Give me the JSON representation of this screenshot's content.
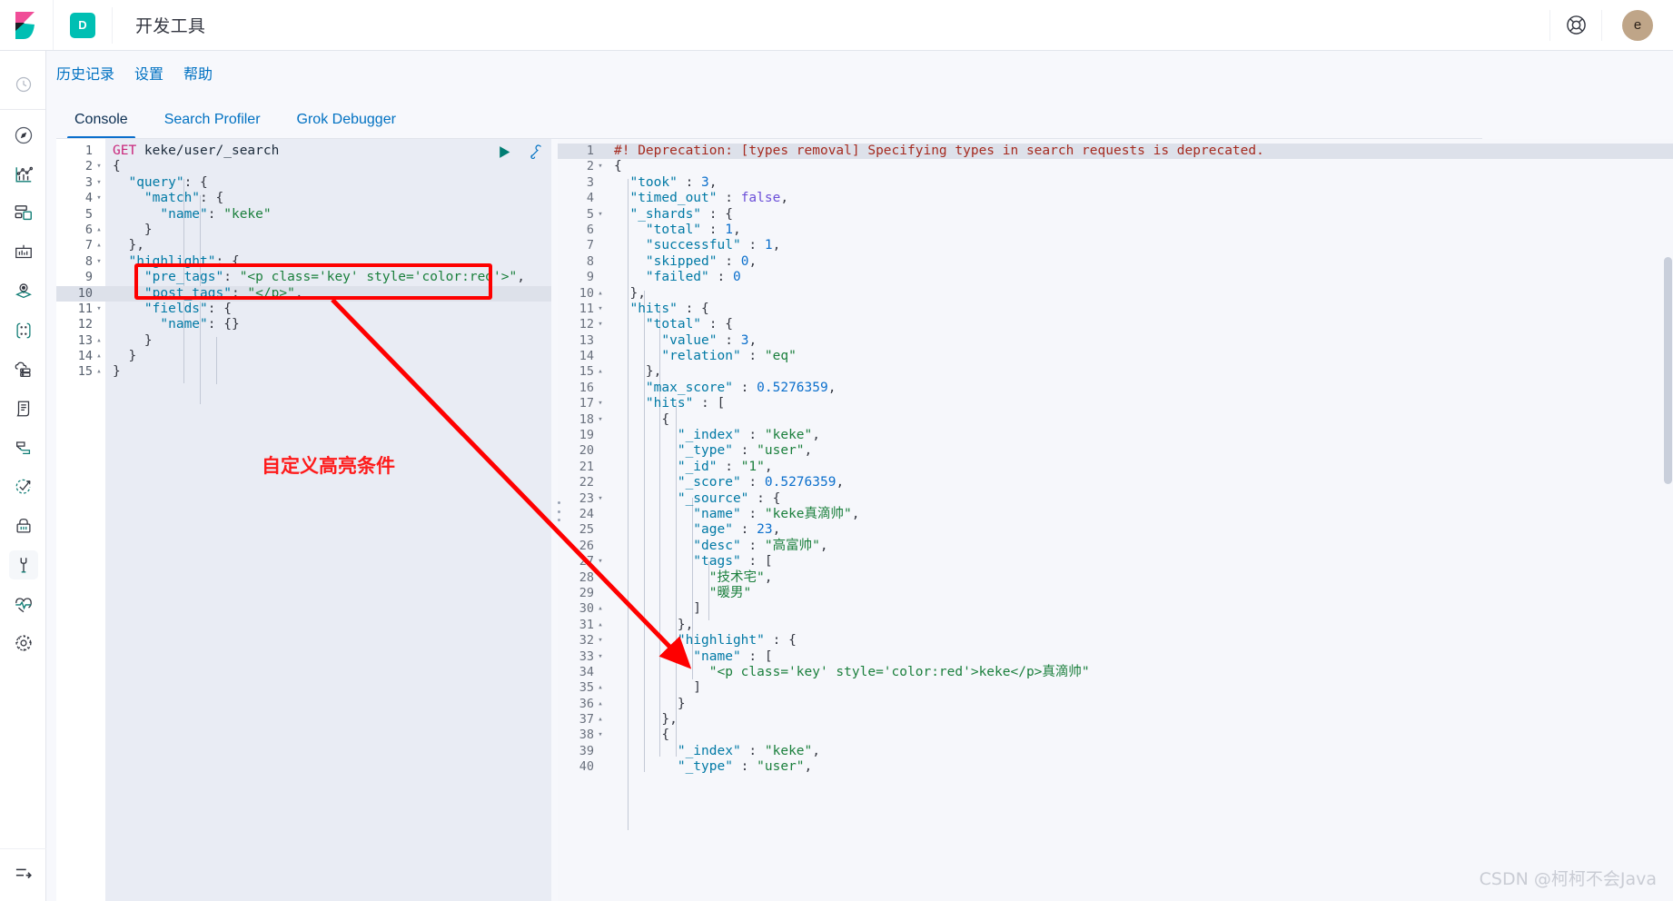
{
  "header": {
    "logo_icon": "kibana-logo-icon",
    "app_badge": "D",
    "title": "开发工具",
    "help_icon": "help-lifering-icon",
    "avatar_initial": "e"
  },
  "rail": {
    "items": [
      {
        "icon": "recently-viewed-clock-icon",
        "name": "recently-viewed"
      },
      {
        "icon": "compass-discover-icon",
        "name": "discover"
      },
      {
        "icon": "visualize-chart-icon",
        "name": "visualize"
      },
      {
        "icon": "dashboard-grid-icon",
        "name": "dashboard"
      },
      {
        "icon": "canvas-easel-icon",
        "name": "canvas"
      },
      {
        "icon": "maps-layers-pin-icon",
        "name": "maps"
      },
      {
        "icon": "machine-learning-nodes-icon",
        "name": "machine-learning"
      },
      {
        "icon": "infrastructure-cloud-server-icon",
        "name": "infrastructure"
      },
      {
        "icon": "logs-scroll-icon",
        "name": "logs"
      },
      {
        "icon": "apm-stack-icon",
        "name": "apm"
      },
      {
        "icon": "uptime-check-arrow-icon",
        "name": "uptime"
      },
      {
        "icon": "siem-lock-icon",
        "name": "siem"
      },
      {
        "icon": "dev-tools-wrench-icon",
        "name": "dev-tools",
        "selected": true
      },
      {
        "icon": "monitoring-heartbeat-icon",
        "name": "monitoring"
      },
      {
        "icon": "management-gear-icon",
        "name": "management"
      }
    ],
    "collapse_icon": "collapse-arrow-icon"
  },
  "subnav": {
    "items": [
      {
        "label": "历史记录",
        "name": "history"
      },
      {
        "label": "设置",
        "name": "settings"
      },
      {
        "label": "帮助",
        "name": "help"
      }
    ]
  },
  "tabs": [
    {
      "label": "Console",
      "name": "console",
      "active": true
    },
    {
      "label": "Search Profiler",
      "name": "search-profiler",
      "active": false
    },
    {
      "label": "Grok Debugger",
      "name": "grok-debugger",
      "active": false
    }
  ],
  "editor_actions": {
    "run_icon": "play-run-icon",
    "wrench_icon": "wrench-settings-icon"
  },
  "request_editor": {
    "name": "request-editor",
    "highlighted_line": 10,
    "lines": [
      {
        "n": 1,
        "fold": "",
        "tokens": [
          {
            "c": "t-method",
            "t": "GET"
          },
          {
            "c": "t-url",
            "t": " keke/user/_search"
          }
        ]
      },
      {
        "n": 2,
        "fold": "▾",
        "tokens": [
          {
            "c": "t-punc",
            "t": "{"
          }
        ]
      },
      {
        "n": 3,
        "fold": "▾",
        "tokens": [
          {
            "c": "t-key",
            "t": "  \"query\""
          },
          {
            "c": "t-punc",
            "t": ": {"
          }
        ]
      },
      {
        "n": 4,
        "fold": "▾",
        "tokens": [
          {
            "c": "t-key",
            "t": "    \"match\""
          },
          {
            "c": "t-punc",
            "t": ": {"
          }
        ]
      },
      {
        "n": 5,
        "fold": "",
        "tokens": [
          {
            "c": "t-key",
            "t": "      \"name\""
          },
          {
            "c": "t-punc",
            "t": ": "
          },
          {
            "c": "t-str",
            "t": "\"keke\""
          }
        ]
      },
      {
        "n": 6,
        "fold": "▴",
        "tokens": [
          {
            "c": "t-punc",
            "t": "    }"
          }
        ]
      },
      {
        "n": 7,
        "fold": "▴",
        "tokens": [
          {
            "c": "t-punc",
            "t": "  },"
          }
        ]
      },
      {
        "n": 8,
        "fold": "▾",
        "tokens": [
          {
            "c": "t-key",
            "t": "  \"highlight\""
          },
          {
            "c": "t-punc",
            "t": ": {"
          }
        ]
      },
      {
        "n": 9,
        "fold": "",
        "tokens": [
          {
            "c": "t-key",
            "t": "    \"pre_tags\""
          },
          {
            "c": "t-punc",
            "t": ": "
          },
          {
            "c": "t-str",
            "t": "\"<p class='key' style='color:red'>\""
          },
          {
            "c": "t-punc",
            "t": ","
          }
        ]
      },
      {
        "n": 10,
        "fold": "",
        "tokens": [
          {
            "c": "t-key",
            "t": "    \"post_tags\""
          },
          {
            "c": "t-punc",
            "t": ": "
          },
          {
            "c": "t-str",
            "t": "\"</p>\""
          },
          {
            "c": "t-punc",
            "t": ","
          }
        ]
      },
      {
        "n": 11,
        "fold": "▾",
        "tokens": [
          {
            "c": "t-key",
            "t": "    \"fields\""
          },
          {
            "c": "t-punc",
            "t": ": {"
          }
        ]
      },
      {
        "n": 12,
        "fold": "",
        "tokens": [
          {
            "c": "t-key",
            "t": "      \"name\""
          },
          {
            "c": "t-punc",
            "t": ": {}"
          }
        ]
      },
      {
        "n": 13,
        "fold": "▴",
        "tokens": [
          {
            "c": "t-punc",
            "t": "    }"
          }
        ]
      },
      {
        "n": 14,
        "fold": "▴",
        "tokens": [
          {
            "c": "t-punc",
            "t": "  }"
          }
        ]
      },
      {
        "n": 15,
        "fold": "▴",
        "tokens": [
          {
            "c": "t-punc",
            "t": "}"
          }
        ]
      }
    ]
  },
  "response_editor": {
    "name": "response-output",
    "highlighted_line": 1,
    "lines": [
      {
        "n": 1,
        "fold": "",
        "tokens": [
          {
            "c": "t-dep",
            "t": "#! Deprecation: [types removal] Specifying types in search requests is deprecated."
          }
        ]
      },
      {
        "n": 2,
        "fold": "▾",
        "tokens": [
          {
            "c": "t-punc",
            "t": "{"
          }
        ]
      },
      {
        "n": 3,
        "fold": "",
        "tokens": [
          {
            "c": "t-key",
            "t": "  \"took\""
          },
          {
            "c": "t-punc",
            "t": " : "
          },
          {
            "c": "t-num",
            "t": "3"
          },
          {
            "c": "t-punc",
            "t": ","
          }
        ]
      },
      {
        "n": 4,
        "fold": "",
        "tokens": [
          {
            "c": "t-key",
            "t": "  \"timed_out\""
          },
          {
            "c": "t-punc",
            "t": " : "
          },
          {
            "c": "t-bool",
            "t": "false"
          },
          {
            "c": "t-punc",
            "t": ","
          }
        ]
      },
      {
        "n": 5,
        "fold": "▾",
        "tokens": [
          {
            "c": "t-key",
            "t": "  \"_shards\""
          },
          {
            "c": "t-punc",
            "t": " : {"
          }
        ]
      },
      {
        "n": 6,
        "fold": "",
        "tokens": [
          {
            "c": "t-key",
            "t": "    \"total\""
          },
          {
            "c": "t-punc",
            "t": " : "
          },
          {
            "c": "t-num",
            "t": "1"
          },
          {
            "c": "t-punc",
            "t": ","
          }
        ]
      },
      {
        "n": 7,
        "fold": "",
        "tokens": [
          {
            "c": "t-key",
            "t": "    \"successful\""
          },
          {
            "c": "t-punc",
            "t": " : "
          },
          {
            "c": "t-num",
            "t": "1"
          },
          {
            "c": "t-punc",
            "t": ","
          }
        ]
      },
      {
        "n": 8,
        "fold": "",
        "tokens": [
          {
            "c": "t-key",
            "t": "    \"skipped\""
          },
          {
            "c": "t-punc",
            "t": " : "
          },
          {
            "c": "t-num",
            "t": "0"
          },
          {
            "c": "t-punc",
            "t": ","
          }
        ]
      },
      {
        "n": 9,
        "fold": "",
        "tokens": [
          {
            "c": "t-key",
            "t": "    \"failed\""
          },
          {
            "c": "t-punc",
            "t": " : "
          },
          {
            "c": "t-num",
            "t": "0"
          }
        ]
      },
      {
        "n": 10,
        "fold": "▴",
        "tokens": [
          {
            "c": "t-punc",
            "t": "  },"
          }
        ]
      },
      {
        "n": 11,
        "fold": "▾",
        "tokens": [
          {
            "c": "t-key",
            "t": "  \"hits\""
          },
          {
            "c": "t-punc",
            "t": " : {"
          }
        ]
      },
      {
        "n": 12,
        "fold": "▾",
        "tokens": [
          {
            "c": "t-key",
            "t": "    \"total\""
          },
          {
            "c": "t-punc",
            "t": " : {"
          }
        ]
      },
      {
        "n": 13,
        "fold": "",
        "tokens": [
          {
            "c": "t-key",
            "t": "      \"value\""
          },
          {
            "c": "t-punc",
            "t": " : "
          },
          {
            "c": "t-num",
            "t": "3"
          },
          {
            "c": "t-punc",
            "t": ","
          }
        ]
      },
      {
        "n": 14,
        "fold": "",
        "tokens": [
          {
            "c": "t-key",
            "t": "      \"relation\""
          },
          {
            "c": "t-punc",
            "t": " : "
          },
          {
            "c": "t-str",
            "t": "\"eq\""
          }
        ]
      },
      {
        "n": 15,
        "fold": "▴",
        "tokens": [
          {
            "c": "t-punc",
            "t": "    },"
          }
        ]
      },
      {
        "n": 16,
        "fold": "",
        "tokens": [
          {
            "c": "t-key",
            "t": "    \"max_score\""
          },
          {
            "c": "t-punc",
            "t": " : "
          },
          {
            "c": "t-num",
            "t": "0.5276359"
          },
          {
            "c": "t-punc",
            "t": ","
          }
        ]
      },
      {
        "n": 17,
        "fold": "▾",
        "tokens": [
          {
            "c": "t-key",
            "t": "    \"hits\""
          },
          {
            "c": "t-punc",
            "t": " : ["
          }
        ]
      },
      {
        "n": 18,
        "fold": "▾",
        "tokens": [
          {
            "c": "t-punc",
            "t": "      {"
          }
        ]
      },
      {
        "n": 19,
        "fold": "",
        "tokens": [
          {
            "c": "t-key",
            "t": "        \"_index\""
          },
          {
            "c": "t-punc",
            "t": " : "
          },
          {
            "c": "t-str",
            "t": "\"keke\""
          },
          {
            "c": "t-punc",
            "t": ","
          }
        ]
      },
      {
        "n": 20,
        "fold": "",
        "tokens": [
          {
            "c": "t-key",
            "t": "        \"_type\""
          },
          {
            "c": "t-punc",
            "t": " : "
          },
          {
            "c": "t-str",
            "t": "\"user\""
          },
          {
            "c": "t-punc",
            "t": ","
          }
        ]
      },
      {
        "n": 21,
        "fold": "",
        "tokens": [
          {
            "c": "t-key",
            "t": "        \"_id\""
          },
          {
            "c": "t-punc",
            "t": " : "
          },
          {
            "c": "t-str",
            "t": "\"1\""
          },
          {
            "c": "t-punc",
            "t": ","
          }
        ]
      },
      {
        "n": 22,
        "fold": "",
        "tokens": [
          {
            "c": "t-key",
            "t": "        \"_score\""
          },
          {
            "c": "t-punc",
            "t": " : "
          },
          {
            "c": "t-num",
            "t": "0.5276359"
          },
          {
            "c": "t-punc",
            "t": ","
          }
        ]
      },
      {
        "n": 23,
        "fold": "▾",
        "tokens": [
          {
            "c": "t-key",
            "t": "        \"_source\""
          },
          {
            "c": "t-punc",
            "t": " : {"
          }
        ]
      },
      {
        "n": 24,
        "fold": "",
        "tokens": [
          {
            "c": "t-key",
            "t": "          \"name\""
          },
          {
            "c": "t-punc",
            "t": " : "
          },
          {
            "c": "t-str",
            "t": "\"keke真滴帅\""
          },
          {
            "c": "t-punc",
            "t": ","
          }
        ]
      },
      {
        "n": 25,
        "fold": "",
        "tokens": [
          {
            "c": "t-key",
            "t": "          \"age\""
          },
          {
            "c": "t-punc",
            "t": " : "
          },
          {
            "c": "t-num",
            "t": "23"
          },
          {
            "c": "t-punc",
            "t": ","
          }
        ]
      },
      {
        "n": 26,
        "fold": "",
        "tokens": [
          {
            "c": "t-key",
            "t": "          \"desc\""
          },
          {
            "c": "t-punc",
            "t": " : "
          },
          {
            "c": "t-str",
            "t": "\"高富帅\""
          },
          {
            "c": "t-punc",
            "t": ","
          }
        ]
      },
      {
        "n": 27,
        "fold": "▾",
        "tokens": [
          {
            "c": "t-key",
            "t": "          \"tags\""
          },
          {
            "c": "t-punc",
            "t": " : ["
          }
        ]
      },
      {
        "n": 28,
        "fold": "",
        "tokens": [
          {
            "c": "t-str",
            "t": "            \"技术宅\""
          },
          {
            "c": "t-punc",
            "t": ","
          }
        ]
      },
      {
        "n": 29,
        "fold": "",
        "tokens": [
          {
            "c": "t-str",
            "t": "            \"暖男\""
          }
        ]
      },
      {
        "n": 30,
        "fold": "▴",
        "tokens": [
          {
            "c": "t-punc",
            "t": "          ]"
          }
        ]
      },
      {
        "n": 31,
        "fold": "▴",
        "tokens": [
          {
            "c": "t-punc",
            "t": "        },"
          }
        ]
      },
      {
        "n": 32,
        "fold": "▾",
        "tokens": [
          {
            "c": "t-key",
            "t": "        \"highlight\""
          },
          {
            "c": "t-punc",
            "t": " : {"
          }
        ]
      },
      {
        "n": 33,
        "fold": "▾",
        "tokens": [
          {
            "c": "t-key",
            "t": "          \"name\""
          },
          {
            "c": "t-punc",
            "t": " : ["
          }
        ]
      },
      {
        "n": 34,
        "fold": "",
        "tokens": [
          {
            "c": "t-str",
            "t": "            \"<p class='key' style='color:red'>keke</p>真滴帅\""
          }
        ]
      },
      {
        "n": 35,
        "fold": "▴",
        "tokens": [
          {
            "c": "t-punc",
            "t": "          ]"
          }
        ]
      },
      {
        "n": 36,
        "fold": "▴",
        "tokens": [
          {
            "c": "t-punc",
            "t": "        }"
          }
        ]
      },
      {
        "n": 37,
        "fold": "▴",
        "tokens": [
          {
            "c": "t-punc",
            "t": "      },"
          }
        ]
      },
      {
        "n": 38,
        "fold": "▾",
        "tokens": [
          {
            "c": "t-punc",
            "t": "      {"
          }
        ]
      },
      {
        "n": 39,
        "fold": "",
        "tokens": [
          {
            "c": "t-key",
            "t": "        \"_index\""
          },
          {
            "c": "t-punc",
            "t": " : "
          },
          {
            "c": "t-str",
            "t": "\"keke\""
          },
          {
            "c": "t-punc",
            "t": ","
          }
        ]
      },
      {
        "n": 40,
        "fold": "",
        "tokens": [
          {
            "c": "t-key",
            "t": "        \"_type\""
          },
          {
            "c": "t-punc",
            "t": " : "
          },
          {
            "c": "t-str",
            "t": "\"user\""
          },
          {
            "c": "t-punc",
            "t": ","
          }
        ]
      }
    ]
  },
  "annotations": {
    "label": "自定义高亮条件",
    "accent_color": "#fe0000"
  },
  "watermark": "CSDN @柯柯不会Java"
}
